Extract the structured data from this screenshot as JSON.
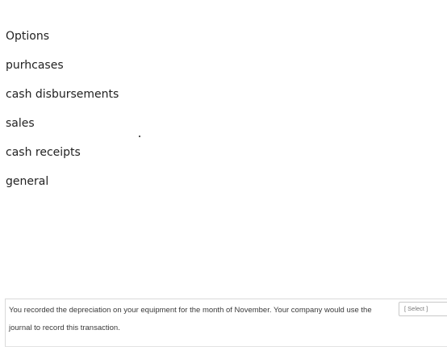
{
  "options": {
    "heading": "Options",
    "items": [
      "purhcases",
      "cash disbursements",
      "sales",
      "cash receipts",
      "general"
    ]
  },
  "question": {
    "text_before": "You recorded the depreciation on your equipment for the month of November. Your company would use the",
    "select_label": "[ Select ]",
    "text_after": "journal to record this transaction."
  }
}
